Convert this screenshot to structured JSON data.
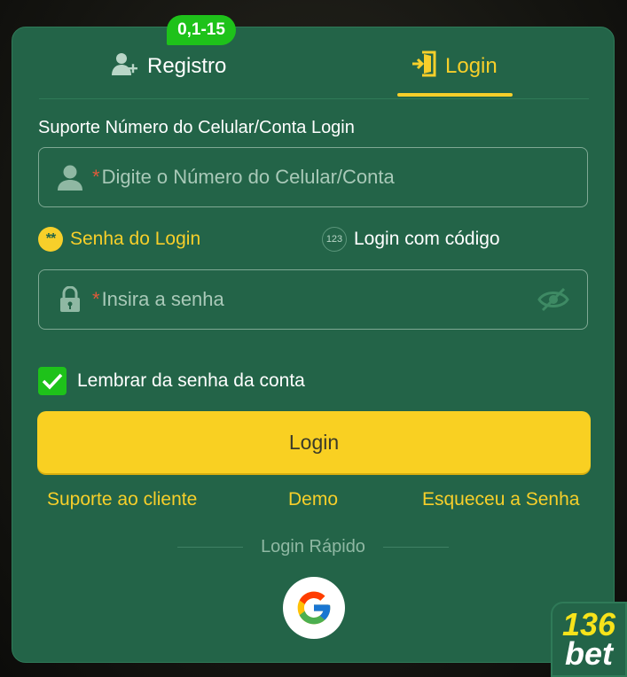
{
  "tabs": {
    "register_label": "Registro",
    "login_label": "Login",
    "register_badge": "0,1-15"
  },
  "form": {
    "section_label": "Suporte Número do Celular/Conta Login",
    "account_placeholder": "Digite o Número do Celular/Conta",
    "password_placeholder": "Insira a senha",
    "required_mark": "*",
    "mode_password_label": "Senha do Login",
    "mode_password_icon_text": "**",
    "mode_code_label": "Login com código",
    "mode_code_icon_text": "123",
    "remember_label": "Lembrar da senha da conta",
    "remember_checked": true,
    "submit_label": "Login"
  },
  "links": {
    "support": "Suporte ao cliente",
    "demo": "Demo",
    "forgot": "Esqueceu a Senha"
  },
  "quick_login": {
    "label": "Login Rápido",
    "providers": [
      "google-icon"
    ]
  },
  "brand": {
    "logo_line1": "136",
    "logo_line2": "bet"
  },
  "colors": {
    "panel": "#236448",
    "accent": "#f7cf2a",
    "badge": "#1ec21a"
  }
}
